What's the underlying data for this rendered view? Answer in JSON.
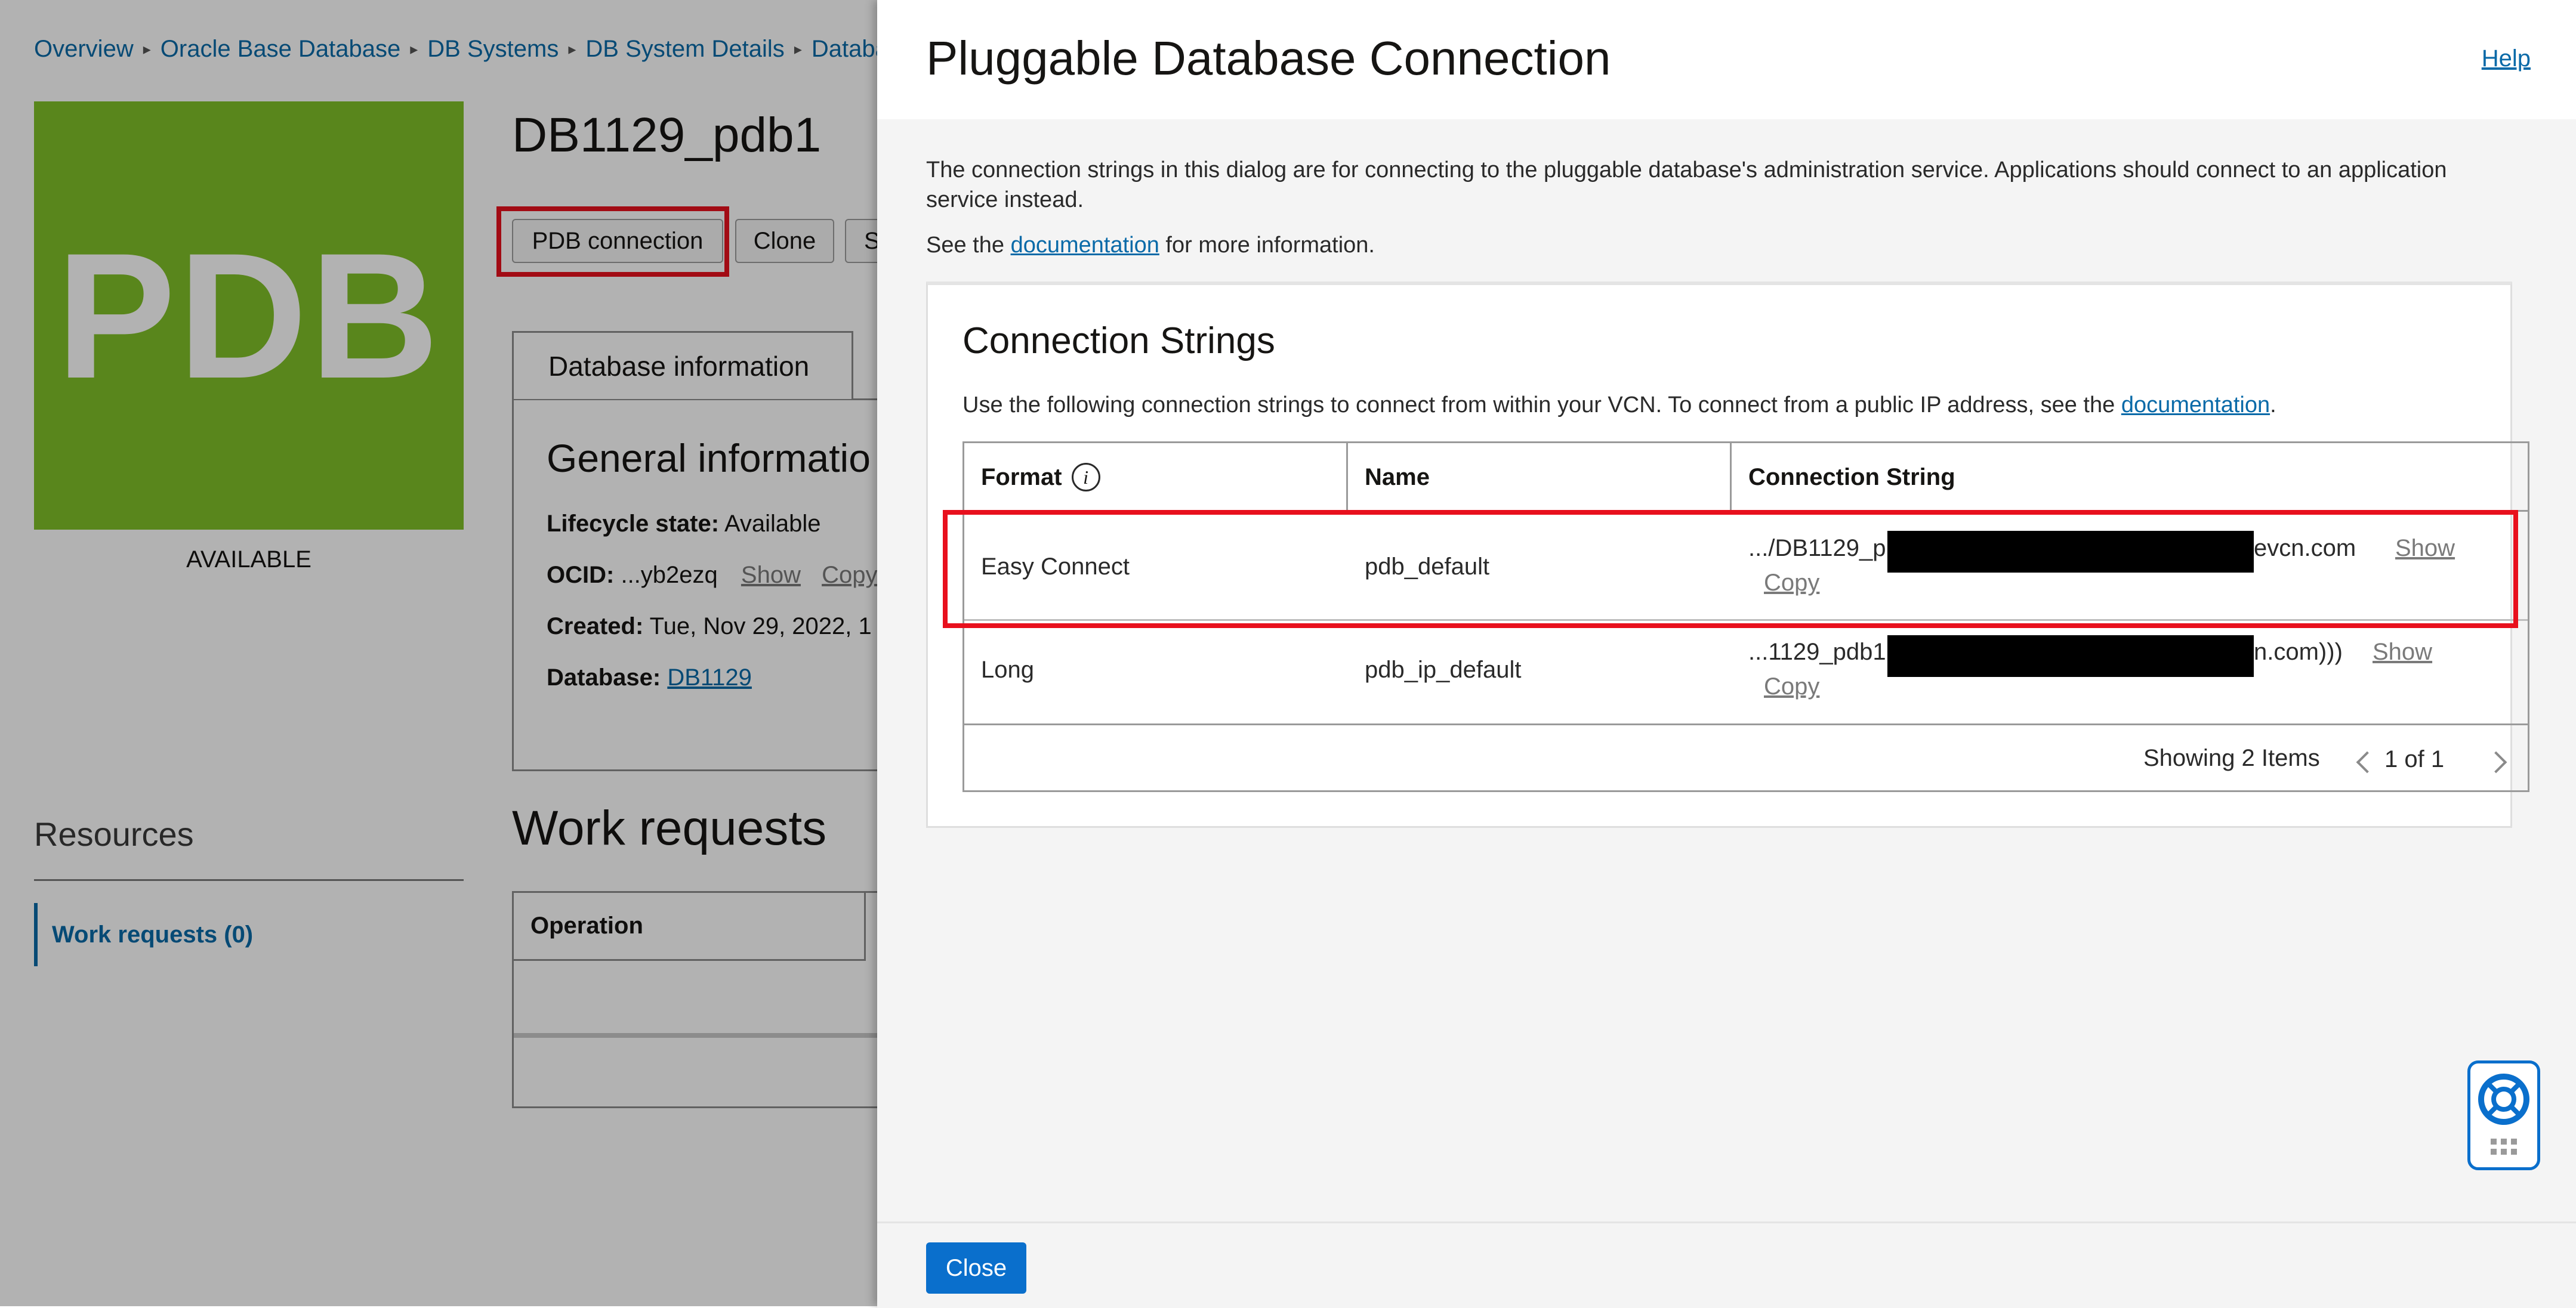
{
  "background": {
    "breadcrumbs": [
      "Overview",
      "Oracle Base Database",
      "DB Systems",
      "DB System Details",
      "Databa"
    ],
    "tile_text": "PDB",
    "status": "AVAILABLE",
    "title": "DB1129_pdb1",
    "buttons": {
      "pdb_connection": "PDB connection",
      "clone": "Clone",
      "more": "S"
    },
    "tab_database_information": "Database information",
    "general_information_title": "General informatio",
    "lifecycle": {
      "label": "Lifecycle state:",
      "value": "Available"
    },
    "ocid": {
      "label": "OCID:",
      "value": "...yb2ezq",
      "show": "Show",
      "copy": "Copy"
    },
    "created": {
      "label": "Created:",
      "value": "Tue, Nov 29, 2022, 1"
    },
    "database": {
      "label": "Database:",
      "value": "DB1129"
    },
    "resources_title": "Resources",
    "resources_item": "Work requests (0)",
    "work_requests_title": "Work requests",
    "work_requests_column": "Operation"
  },
  "dialog": {
    "title": "Pluggable Database Connection",
    "help": "Help",
    "intro": "The connection strings in this dialog are for connecting to the pluggable database's administration service. Applications should connect to an application service instead.",
    "see_prefix": "See the",
    "see_link": "documentation",
    "see_suffix": "for more information.",
    "card": {
      "title": "Connection Strings",
      "subtitle_prefix": "Use the following connection strings to connect from within your VCN. To connect from a public IP address, see the",
      "subtitle_link": "documentation",
      "subtitle_suffix": ".",
      "columns": {
        "format": "Format",
        "name": "Name",
        "connection_string": "Connection String"
      },
      "rows": [
        {
          "format": "Easy Connect",
          "name": "pdb_default",
          "conn_prefix": ".../DB1129_p",
          "conn_suffix": "evcn.com",
          "show": "Show",
          "copy": "Copy"
        },
        {
          "format": "Long",
          "name": "pdb_ip_default",
          "conn_prefix": "...1129_pdb1.",
          "conn_suffix": "n.com)))",
          "show": "Show",
          "copy": "Copy"
        }
      ],
      "showing": "Showing 2 Items",
      "page": "1 of 1"
    },
    "close": "Close"
  },
  "colors": {
    "accent": "#0a6fcc",
    "link": "#0a6aa8",
    "tile_green": "#80c029",
    "highlight_red": "#e8101d"
  },
  "icons": [
    "chevron-right-icon",
    "info-icon",
    "chevron-left-icon",
    "help-lifebuoy-icon",
    "grid-dots-icon"
  ]
}
